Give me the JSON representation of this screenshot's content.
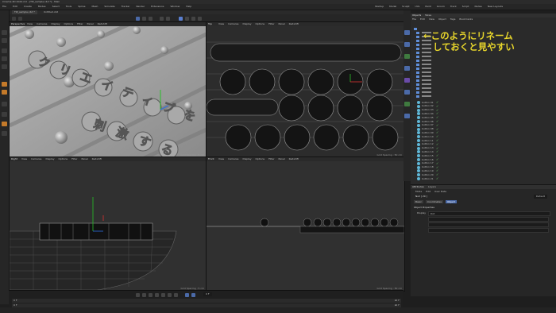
{
  "window": {
    "title": "Cinema 4D 2024.2.0 - [Tilt_sample.c4d *] - Main",
    "doc_tabs": [
      "Tilt_sample.c4d *",
      "Untitled.c4d"
    ]
  },
  "menu": [
    "File",
    "Edit",
    "Create",
    "Modes",
    "Select",
    "Tools",
    "Spline",
    "Mesh",
    "Simulate",
    "Tracker",
    "Render",
    "Extensions",
    "Window",
    "Help"
  ],
  "layouts": [
    "Startup",
    "Model",
    "Sculpt",
    "UVs",
    "Paint",
    "Groom",
    "Track",
    "Script",
    "Nodes",
    "New Layouts"
  ],
  "viewports": {
    "perspective": {
      "name": "Perspective",
      "menu": [
        "View",
        "Cameras",
        "Display",
        "Options",
        "Filter",
        "Panel",
        "Redshift"
      ],
      "grid": "Grid Spacing : 5 cm"
    },
    "top": {
      "name": "Top",
      "menu": [
        "View",
        "Cameras",
        "Display",
        "Options",
        "Filter",
        "Panel",
        "Redshift"
      ],
      "grid": "Grid Spacing : 50 cm"
    },
    "right": {
      "name": "Right",
      "menu": [
        "View",
        "Cameras",
        "Display",
        "Options",
        "Filter",
        "Panel",
        "Redshift"
      ],
      "grid": "Grid Spacing : 5 cm"
    },
    "front": {
      "name": "Front",
      "menu": [
        "View",
        "Cameras",
        "Display",
        "Options",
        "Filter",
        "Panel",
        "Redshift"
      ],
      "grid": "Grid Spacing : 50 cm"
    }
  },
  "scene_text": {
    "line1": "クリエイティブを",
    "line2": "刺激する"
  },
  "object_manager": {
    "tabs": [
      "Objects",
      "Takes"
    ],
    "menu": [
      "File",
      "Edit",
      "View",
      "Object",
      "Tags",
      "Bookmarks"
    ],
    "items": [
      "button 01",
      "button 02",
      "button 03",
      "button 04",
      "button 05",
      "button 06",
      "button 07",
      "button 08",
      "button 09",
      "button 10",
      "button 11",
      "button 12",
      "button 13",
      "button 14",
      "button 15",
      "button 16",
      "button 17",
      "button 18",
      "button 19",
      "button 20",
      "button 21"
    ]
  },
  "annotation": {
    "line1": "←このようにリネーム",
    "line2": "しておくと見やすい"
  },
  "attributes": {
    "tabs": [
      "Attributes",
      "Layers"
    ],
    "menu": [
      "Mode",
      "Edit",
      "User Data"
    ],
    "object_name": "Null [ 29 ]",
    "preset": "Default",
    "subtabs": [
      "Basic",
      "Coordinates",
      "Object"
    ],
    "section": "Object Properties",
    "shape_label": "Display",
    "shape_value": "Dot"
  },
  "timeline": {
    "start": "0 F",
    "end": "90 F",
    "current": "0 F",
    "range_start": "0 F",
    "range_end": "90 F"
  },
  "colors": {
    "annotation": "#e8d62b",
    "accent": "#4b6aa8",
    "check": "#6cd36c"
  }
}
